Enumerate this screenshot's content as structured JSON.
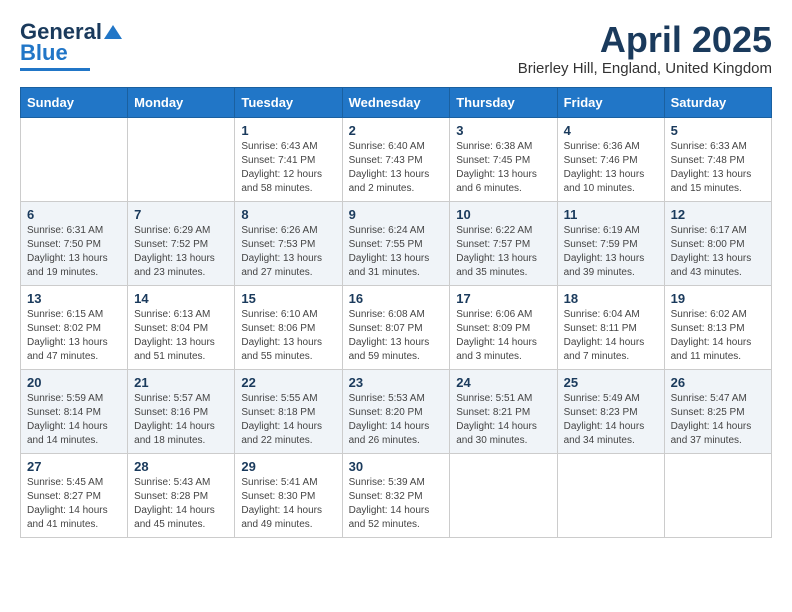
{
  "logo": {
    "line1": "General",
    "line2": "Blue"
  },
  "title": "April 2025",
  "subtitle": "Brierley Hill, England, United Kingdom",
  "days_of_week": [
    "Sunday",
    "Monday",
    "Tuesday",
    "Wednesday",
    "Thursday",
    "Friday",
    "Saturday"
  ],
  "weeks": [
    [
      {
        "day": "",
        "info": ""
      },
      {
        "day": "",
        "info": ""
      },
      {
        "day": "1",
        "info": "Sunrise: 6:43 AM\nSunset: 7:41 PM\nDaylight: 12 hours and 58 minutes."
      },
      {
        "day": "2",
        "info": "Sunrise: 6:40 AM\nSunset: 7:43 PM\nDaylight: 13 hours and 2 minutes."
      },
      {
        "day": "3",
        "info": "Sunrise: 6:38 AM\nSunset: 7:45 PM\nDaylight: 13 hours and 6 minutes."
      },
      {
        "day": "4",
        "info": "Sunrise: 6:36 AM\nSunset: 7:46 PM\nDaylight: 13 hours and 10 minutes."
      },
      {
        "day": "5",
        "info": "Sunrise: 6:33 AM\nSunset: 7:48 PM\nDaylight: 13 hours and 15 minutes."
      }
    ],
    [
      {
        "day": "6",
        "info": "Sunrise: 6:31 AM\nSunset: 7:50 PM\nDaylight: 13 hours and 19 minutes."
      },
      {
        "day": "7",
        "info": "Sunrise: 6:29 AM\nSunset: 7:52 PM\nDaylight: 13 hours and 23 minutes."
      },
      {
        "day": "8",
        "info": "Sunrise: 6:26 AM\nSunset: 7:53 PM\nDaylight: 13 hours and 27 minutes."
      },
      {
        "day": "9",
        "info": "Sunrise: 6:24 AM\nSunset: 7:55 PM\nDaylight: 13 hours and 31 minutes."
      },
      {
        "day": "10",
        "info": "Sunrise: 6:22 AM\nSunset: 7:57 PM\nDaylight: 13 hours and 35 minutes."
      },
      {
        "day": "11",
        "info": "Sunrise: 6:19 AM\nSunset: 7:59 PM\nDaylight: 13 hours and 39 minutes."
      },
      {
        "day": "12",
        "info": "Sunrise: 6:17 AM\nSunset: 8:00 PM\nDaylight: 13 hours and 43 minutes."
      }
    ],
    [
      {
        "day": "13",
        "info": "Sunrise: 6:15 AM\nSunset: 8:02 PM\nDaylight: 13 hours and 47 minutes."
      },
      {
        "day": "14",
        "info": "Sunrise: 6:13 AM\nSunset: 8:04 PM\nDaylight: 13 hours and 51 minutes."
      },
      {
        "day": "15",
        "info": "Sunrise: 6:10 AM\nSunset: 8:06 PM\nDaylight: 13 hours and 55 minutes."
      },
      {
        "day": "16",
        "info": "Sunrise: 6:08 AM\nSunset: 8:07 PM\nDaylight: 13 hours and 59 minutes."
      },
      {
        "day": "17",
        "info": "Sunrise: 6:06 AM\nSunset: 8:09 PM\nDaylight: 14 hours and 3 minutes."
      },
      {
        "day": "18",
        "info": "Sunrise: 6:04 AM\nSunset: 8:11 PM\nDaylight: 14 hours and 7 minutes."
      },
      {
        "day": "19",
        "info": "Sunrise: 6:02 AM\nSunset: 8:13 PM\nDaylight: 14 hours and 11 minutes."
      }
    ],
    [
      {
        "day": "20",
        "info": "Sunrise: 5:59 AM\nSunset: 8:14 PM\nDaylight: 14 hours and 14 minutes."
      },
      {
        "day": "21",
        "info": "Sunrise: 5:57 AM\nSunset: 8:16 PM\nDaylight: 14 hours and 18 minutes."
      },
      {
        "day": "22",
        "info": "Sunrise: 5:55 AM\nSunset: 8:18 PM\nDaylight: 14 hours and 22 minutes."
      },
      {
        "day": "23",
        "info": "Sunrise: 5:53 AM\nSunset: 8:20 PM\nDaylight: 14 hours and 26 minutes."
      },
      {
        "day": "24",
        "info": "Sunrise: 5:51 AM\nSunset: 8:21 PM\nDaylight: 14 hours and 30 minutes."
      },
      {
        "day": "25",
        "info": "Sunrise: 5:49 AM\nSunset: 8:23 PM\nDaylight: 14 hours and 34 minutes."
      },
      {
        "day": "26",
        "info": "Sunrise: 5:47 AM\nSunset: 8:25 PM\nDaylight: 14 hours and 37 minutes."
      }
    ],
    [
      {
        "day": "27",
        "info": "Sunrise: 5:45 AM\nSunset: 8:27 PM\nDaylight: 14 hours and 41 minutes."
      },
      {
        "day": "28",
        "info": "Sunrise: 5:43 AM\nSunset: 8:28 PM\nDaylight: 14 hours and 45 minutes."
      },
      {
        "day": "29",
        "info": "Sunrise: 5:41 AM\nSunset: 8:30 PM\nDaylight: 14 hours and 49 minutes."
      },
      {
        "day": "30",
        "info": "Sunrise: 5:39 AM\nSunset: 8:32 PM\nDaylight: 14 hours and 52 minutes."
      },
      {
        "day": "",
        "info": ""
      },
      {
        "day": "",
        "info": ""
      },
      {
        "day": "",
        "info": ""
      }
    ]
  ]
}
